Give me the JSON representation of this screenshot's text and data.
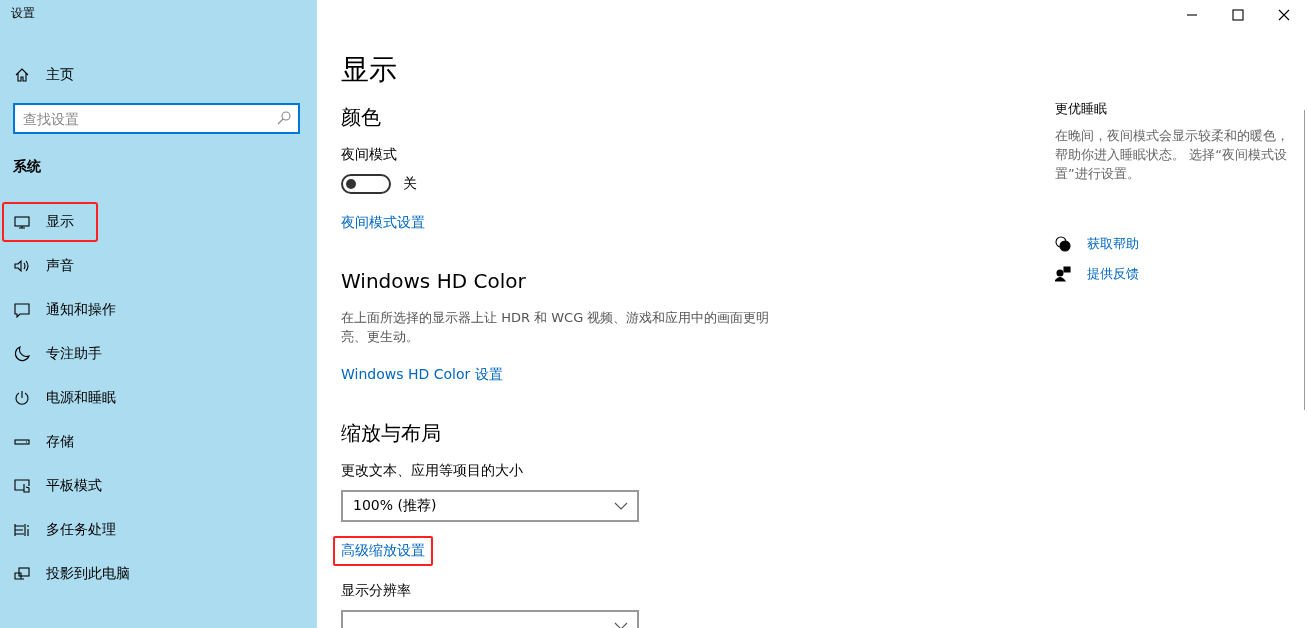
{
  "window": {
    "title": "设置"
  },
  "sidebar": {
    "home": "主页",
    "search": {
      "placeholder": "查找设置"
    },
    "section": "系统",
    "items": [
      {
        "label": "显示",
        "highlighted": true
      },
      {
        "label": "声音",
        "highlighted": false
      },
      {
        "label": "通知和操作",
        "highlighted": false
      },
      {
        "label": "专注助手",
        "highlighted": false
      },
      {
        "label": "电源和睡眠",
        "highlighted": false
      },
      {
        "label": "存储",
        "highlighted": false
      },
      {
        "label": "平板模式",
        "highlighted": false
      },
      {
        "label": "多任务处理",
        "highlighted": false
      },
      {
        "label": "投影到此电脑",
        "highlighted": false
      }
    ]
  },
  "main": {
    "title": "显示",
    "sections": [
      {
        "heading": "颜色",
        "items": [
          {
            "kind": "toggle",
            "label": "夜间模式",
            "on": false,
            "state_text": "关"
          },
          {
            "kind": "link",
            "text": "夜间模式设置",
            "highlighted": false
          }
        ]
      },
      {
        "heading": "Windows HD Color",
        "items": [
          {
            "kind": "text",
            "text": "在上面所选择的显示器上让 HDR 和 WCG 视频、游戏和应用中的画面更明亮、更生动。"
          },
          {
            "kind": "link",
            "text": "Windows HD Color 设置",
            "highlighted": false
          }
        ]
      },
      {
        "heading": "缩放与布局",
        "items": [
          {
            "kind": "dropdown",
            "label": "更改文本、应用等项目的大小",
            "value": "100% (推荐)"
          },
          {
            "kind": "link",
            "text": "高级缩放设置",
            "highlighted": true
          },
          {
            "kind": "dropdown",
            "label": "显示分辨率"
          }
        ]
      }
    ]
  },
  "aside": {
    "heading": "更优睡眠",
    "text": "在晚间，夜间模式会显示较柔和的暖色，帮助你进入睡眠状态。 选择“夜间模式设置”进行设置。",
    "links": [
      "获取帮助",
      "提供反馈"
    ]
  }
}
